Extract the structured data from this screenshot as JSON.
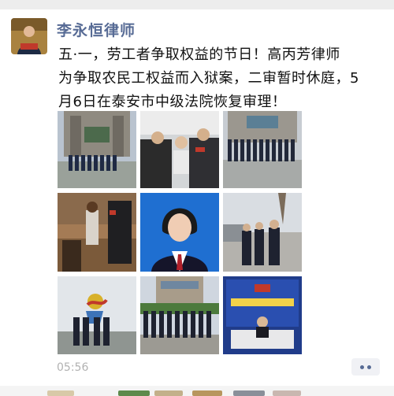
{
  "post": {
    "author": "李永恒律师",
    "text": "五·一，劳工者争取权益的节日！高丙芳律师\n为争取农民工权益而入狱案，二审暂时休庭，5\n月6日在泰安市中级法院恢复审理！",
    "timestamp": "05:56"
  },
  "images": [
    {
      "name": "courthouse-group-photo",
      "kind": "courthouse"
    },
    {
      "name": "police-escort-photo",
      "kind": "escort"
    },
    {
      "name": "courthouse-crowd-photo",
      "kind": "courthouse"
    },
    {
      "name": "courtroom-photo",
      "kind": "courtroom"
    },
    {
      "name": "lawyer-portrait-photo",
      "kind": "portrait"
    },
    {
      "name": "street-group-photo",
      "kind": "street"
    },
    {
      "name": "statue-group-photo",
      "kind": "statue"
    },
    {
      "name": "building-group-photo",
      "kind": "building"
    },
    {
      "name": "awards-stage-photo",
      "kind": "stage"
    }
  ],
  "icons": {
    "more": "more-dots-icon"
  },
  "colors": {
    "author": "#576b95",
    "text": "#111111",
    "timestamp": "#b2b2b2"
  }
}
